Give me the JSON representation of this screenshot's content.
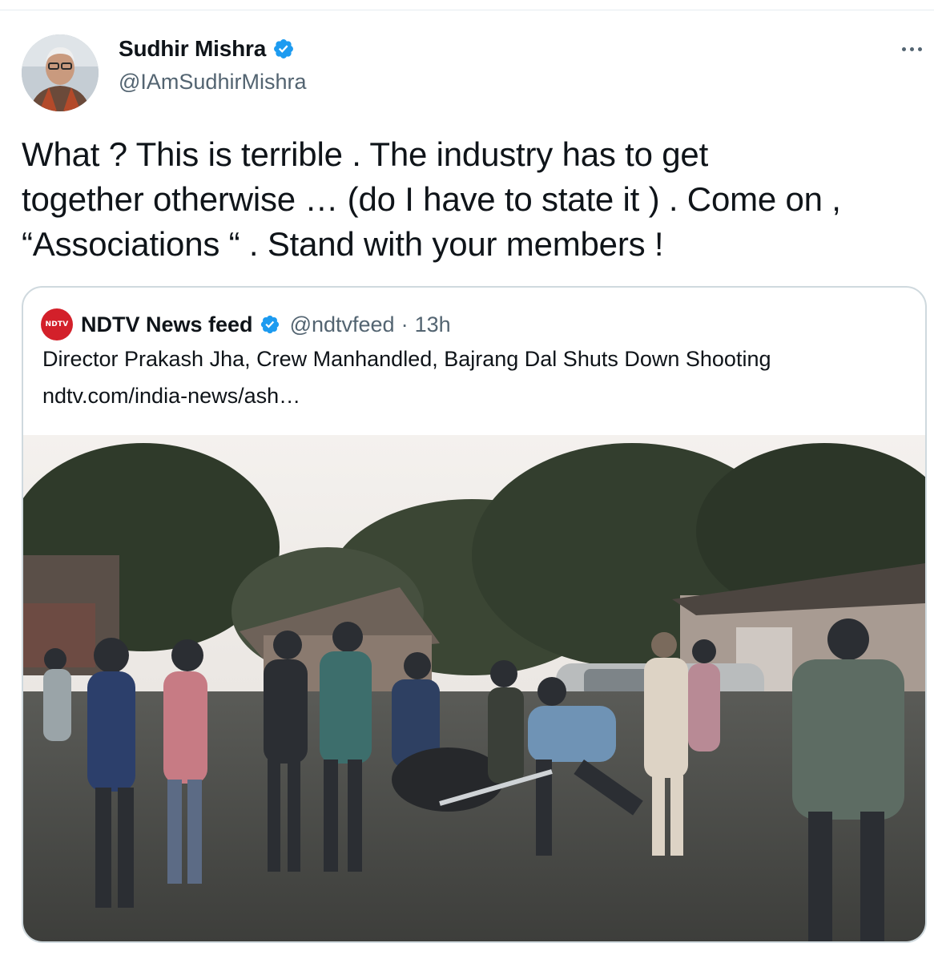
{
  "author": {
    "display_name": "Sudhir Mishra",
    "handle": "@IAmSudhirMishra",
    "verified": true,
    "avatar_icon": "user-avatar-photo"
  },
  "tweet": {
    "lines": [
      "What ? This is terrible . The industry has to get",
      "together otherwise … (do I have to state it ) . Come on ,",
      "“Associations “ . Stand with your members !"
    ]
  },
  "quoted": {
    "logo_text": "NDTV",
    "display_name": "NDTV News feed",
    "handle": "@ndtvfeed",
    "separator": "·",
    "time": "13h",
    "title": "Director Prakash Jha, Crew Manhandled, Bajrang Dal Shuts Down Shooting",
    "link": "ndtv.com/india-news/ash…"
  },
  "colors": {
    "accent": "#1d9bf0",
    "secondary_text": "#536471",
    "ndtv_red": "#d3202a",
    "border": "#cfd9de"
  },
  "icons": {
    "verified": "verified-badge-icon",
    "more": "more-options-icon"
  }
}
